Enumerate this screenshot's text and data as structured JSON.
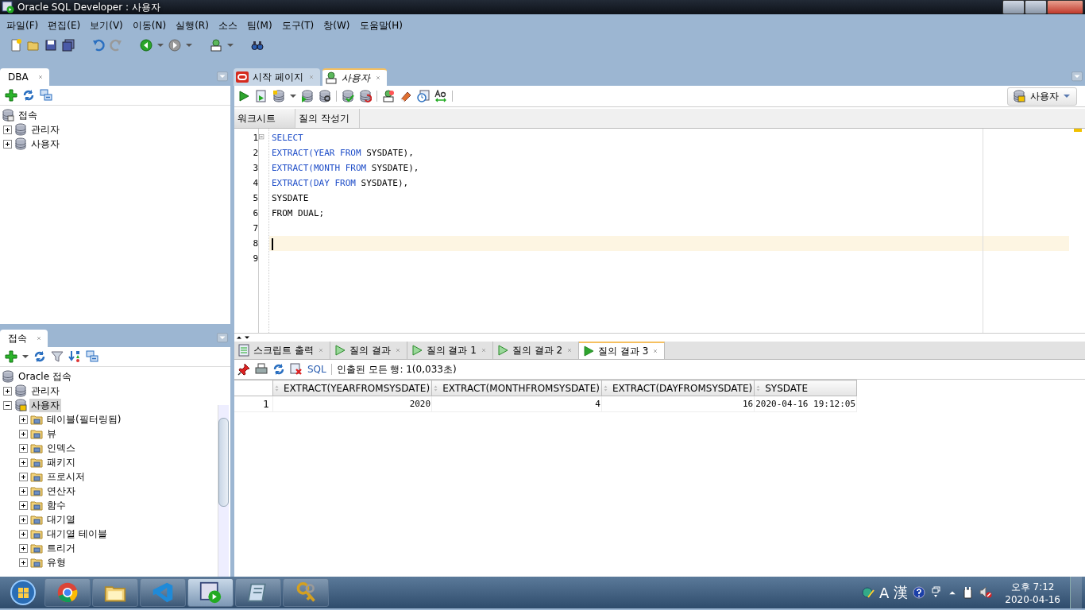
{
  "window": {
    "title": "Oracle SQL Developer : 사용자"
  },
  "menu": [
    "파일(F)",
    "편집(E)",
    "보기(V)",
    "이동(N)",
    "실행(R)",
    "소스",
    "팀(M)",
    "도구(T)",
    "창(W)",
    "도움말(H)"
  ],
  "dba_panel": {
    "tab": "DBA",
    "tree": [
      {
        "label": "접속",
        "kind": "connections",
        "children": [
          {
            "label": "관리자",
            "kind": "database",
            "expanded": false,
            "selected": false
          },
          {
            "label": "사용자",
            "kind": "database",
            "expanded": false,
            "selected": false
          }
        ]
      }
    ]
  },
  "connections_panel": {
    "tab": "접속",
    "tree": [
      {
        "label": "Oracle 접속",
        "kind": "database",
        "children": [
          {
            "label": "관리자",
            "kind": "database",
            "expanded": false,
            "selected": false
          },
          {
            "label": "사용자",
            "kind": "connected",
            "expanded": true,
            "selected": true,
            "children": [
              {
                "label": "테이블(필터링됨)",
                "kind": "folder",
                "expanded": false,
                "selected": false
              },
              {
                "label": "뷰",
                "kind": "folder",
                "expanded": false,
                "selected": false
              },
              {
                "label": "인덱스",
                "kind": "folder",
                "expanded": false,
                "selected": false
              },
              {
                "label": "패키지",
                "kind": "folder",
                "expanded": false,
                "selected": false
              },
              {
                "label": "프로시저",
                "kind": "folder",
                "expanded": false,
                "selected": false
              },
              {
                "label": "연산자",
                "kind": "folder",
                "expanded": false,
                "selected": false
              },
              {
                "label": "함수",
                "kind": "folder",
                "expanded": false,
                "selected": false
              },
              {
                "label": "대기열",
                "kind": "folder",
                "expanded": false,
                "selected": false
              },
              {
                "label": "대기열 테이블",
                "kind": "folder",
                "expanded": false,
                "selected": false
              },
              {
                "label": "트리거",
                "kind": "folder",
                "expanded": false,
                "selected": false
              },
              {
                "label": "유형",
                "kind": "folder",
                "expanded": false,
                "selected": false
              }
            ]
          }
        ]
      }
    ]
  },
  "editor_tabs": [
    {
      "label": "시작 페이지",
      "kind": "start",
      "selected": false
    },
    {
      "label": "사용자",
      "kind": "sql",
      "selected": true
    }
  ],
  "connection_selector": "사용자",
  "sub_tabs": [
    {
      "label": "워크시트",
      "selected": true
    },
    {
      "label": "질의 작성기",
      "selected": false
    }
  ],
  "code_lines": [
    {
      "number": "1",
      "segments": [
        {
          "text": "SELECT",
          "kind": "keyword"
        }
      ]
    },
    {
      "number": "2",
      "segments": [
        {
          "text": "EXTRACT(YEAR ",
          "kind": "keyword"
        },
        {
          "text": "FROM",
          "kind": "keyword"
        },
        {
          "text": " SYSDATE),",
          "kind": "plain"
        }
      ]
    },
    {
      "number": "3",
      "segments": [
        {
          "text": "EXTRACT(MONTH ",
          "kind": "keyword"
        },
        {
          "text": "FROM",
          "kind": "keyword"
        },
        {
          "text": " SYSDATE),",
          "kind": "plain"
        }
      ]
    },
    {
      "number": "4",
      "segments": [
        {
          "text": "EXTRACT(DAY ",
          "kind": "keyword"
        },
        {
          "text": "FROM",
          "kind": "keyword"
        },
        {
          "text": " SYSDATE),",
          "kind": "plain"
        }
      ]
    },
    {
      "number": "5",
      "segments": [
        {
          "text": "SYSDATE",
          "kind": "plain"
        }
      ]
    },
    {
      "number": "6",
      "segments": [
        {
          "text": "FROM DUAL;",
          "kind": "plain"
        }
      ]
    },
    {
      "number": "7"
    },
    {
      "number": "8",
      "current": true
    },
    {
      "number": "9"
    }
  ],
  "result_tabs": [
    {
      "label": "스크립트 출력",
      "kind": "script",
      "selected": false
    },
    {
      "label": "질의 결과",
      "kind": "query",
      "selected": false
    },
    {
      "label": "질의 결과 1",
      "kind": "query",
      "selected": false
    },
    {
      "label": "질의 결과 2",
      "kind": "query",
      "selected": false
    },
    {
      "label": "질의 결과 3",
      "kind": "query",
      "selected": true
    }
  ],
  "result_toolbar": {
    "sql_link": "SQL",
    "status": "인출된 모든 행: 1(0,033초)"
  },
  "grid": {
    "columns": [
      "EXTRACT(YEARFROMSYSDATE)",
      "EXTRACT(MONTHFROMSYSDATE)",
      "EXTRACT(DAYFROMSYSDATE)",
      "SYSDATE"
    ],
    "rows": [
      {
        "number": "1",
        "cells": [
          "2020",
          "4",
          "16",
          "2020-04-16 19:12:05"
        ]
      }
    ]
  },
  "taskbar": {
    "ime_mode": "A",
    "ime_script": "漢",
    "time": "오후 7:12",
    "date": "2020-04-16"
  }
}
